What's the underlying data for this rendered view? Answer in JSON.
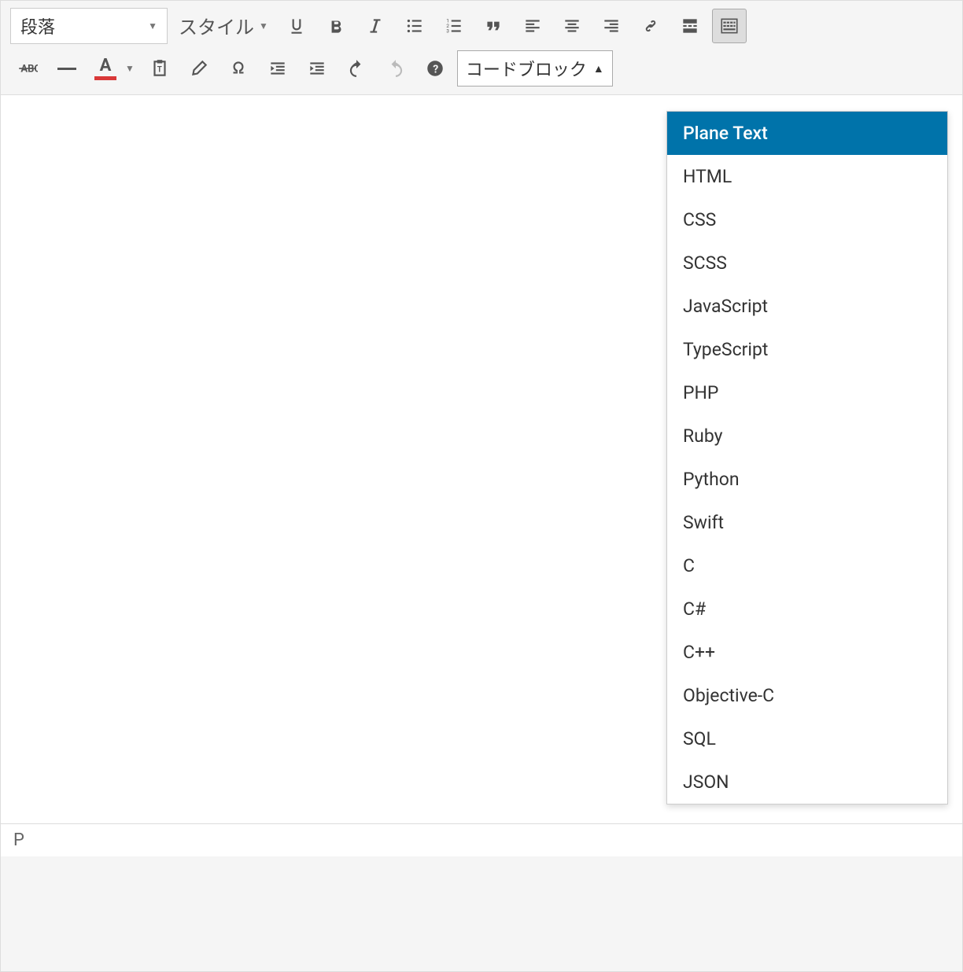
{
  "toolbar": {
    "paragraph_label": "段落",
    "style_label": "スタイル",
    "codeblock_label": "コードブロック"
  },
  "dropdown": {
    "items": [
      "Plane Text",
      "HTML",
      "CSS",
      "SCSS",
      "JavaScript",
      "TypeScript",
      "PHP",
      "Ruby",
      "Python",
      "Swift",
      "C",
      "C#",
      "C++",
      "Objective-C",
      "SQL",
      "JSON"
    ],
    "selected_index": 0
  },
  "status": {
    "path": "P"
  },
  "text_color": {
    "letter": "A",
    "color": "#d93838"
  }
}
